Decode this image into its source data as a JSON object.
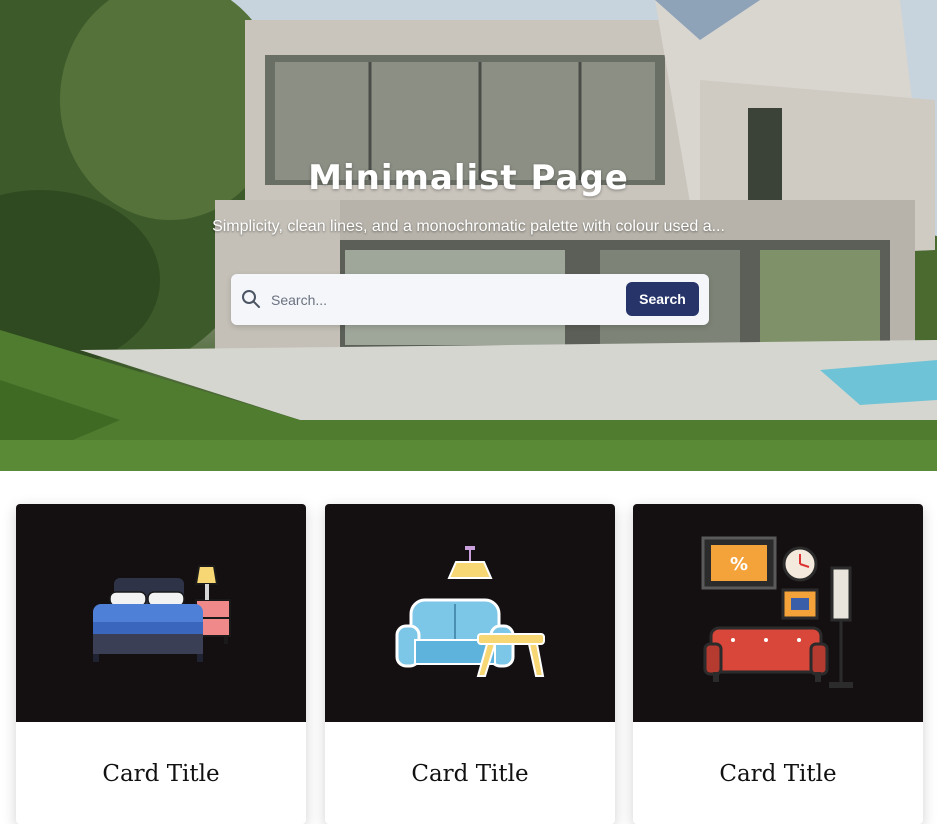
{
  "hero": {
    "title": "Minimalist Page",
    "subtitle": "Simplicity, clean lines, and a monochromatic palette with colour used a..."
  },
  "search": {
    "placeholder": "Search...",
    "button_label": "Search",
    "icon": "search-icon",
    "button_color": "#27346a"
  },
  "cards": [
    {
      "title": "Card Title",
      "icon": "bedroom-illustration"
    },
    {
      "title": "Card Title",
      "icon": "living-room-sofa-illustration"
    },
    {
      "title": "Card Title",
      "icon": "lounge-wall-decor-illustration"
    }
  ],
  "colors": {
    "card_image_bg": "#141011",
    "search_bg": "#f4f6fa"
  }
}
